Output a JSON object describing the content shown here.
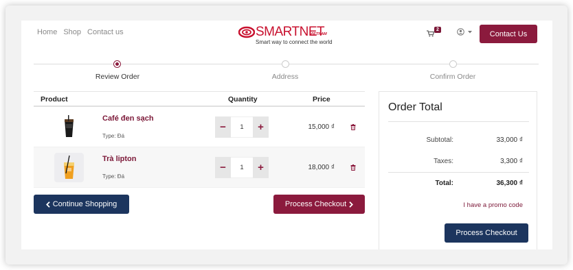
{
  "nav": {
    "links": [
      "Home",
      "Shop",
      "Contact us"
    ]
  },
  "logo": {
    "brand": "SMARTNET",
    "brand_sub": "VIETNAM",
    "tagline": "Smart way to connect the world"
  },
  "cart": {
    "count": "2"
  },
  "header": {
    "contact_label": "Contact Us"
  },
  "steps": [
    "Review Order",
    "Address",
    "Confirm Order"
  ],
  "table": {
    "headers": {
      "product": "Product",
      "quantity": "Quantity",
      "price": "Price"
    },
    "rows": [
      {
        "name": "Café đen sạch",
        "type": "Type: Đá",
        "qty": "1",
        "price": "15,000 ₫"
      },
      {
        "name": "Trà lipton",
        "type": "Type: Đá",
        "qty": "1",
        "price": "18,000 ₫"
      }
    ]
  },
  "buttons": {
    "continue": "Continue Shopping",
    "checkout": "Process Checkout"
  },
  "summary": {
    "title": "Order Total",
    "subtotal_label": "Subtotal:",
    "subtotal": "33,000 ₫",
    "taxes_label": "Taxes:",
    "taxes": "3,300 ₫",
    "total_label": "Total:",
    "total": "36,300 ₫",
    "promo": "I have a promo code",
    "checkout": "Process Checkout"
  },
  "colors": {
    "accent": "#8b1a3d",
    "navy": "#1c355e"
  }
}
